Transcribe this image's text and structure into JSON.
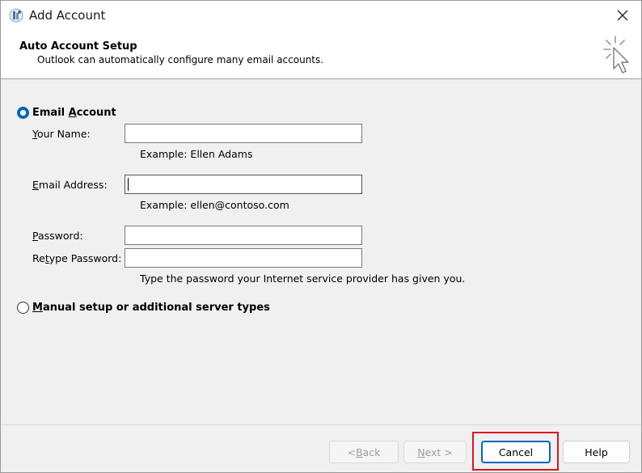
{
  "window": {
    "title": "Add Account",
    "close_icon": "close-icon",
    "app_icon": "outlook-icon"
  },
  "header": {
    "title": "Auto Account Setup",
    "subtitle": "Outlook can automatically configure many email accounts."
  },
  "options": {
    "email_account": {
      "label_prefix": "Email ",
      "label_accel": "A",
      "label_rest": "ccount",
      "selected": true
    },
    "manual_setup": {
      "label_accel": "M",
      "label_rest": "anual setup or additional server types",
      "selected": false
    }
  },
  "fields": {
    "your_name": {
      "label_accel": "Y",
      "label_rest": "our Name:",
      "value": "",
      "hint": "Example: Ellen Adams"
    },
    "email_address": {
      "label_accel": "E",
      "label_rest": "mail Address:",
      "value": "",
      "hint": "Example: ellen@contoso.com"
    },
    "password": {
      "label_accel": "P",
      "label_rest": "assword:",
      "value": ""
    },
    "retype_password": {
      "label_prefix": "Re",
      "label_accel": "t",
      "label_rest": "ype Password:",
      "value": "",
      "hint": "Type the password your Internet service provider has given you."
    }
  },
  "buttons": {
    "back": {
      "prefix": "< ",
      "accel": "B",
      "rest": "ack",
      "enabled": false
    },
    "next": {
      "accel": "N",
      "rest": "ext >",
      "enabled": false
    },
    "cancel": {
      "label": "Cancel"
    },
    "help": {
      "label": "Help"
    }
  },
  "colors": {
    "accent": "#0067c0",
    "highlight": "#e0141e"
  }
}
